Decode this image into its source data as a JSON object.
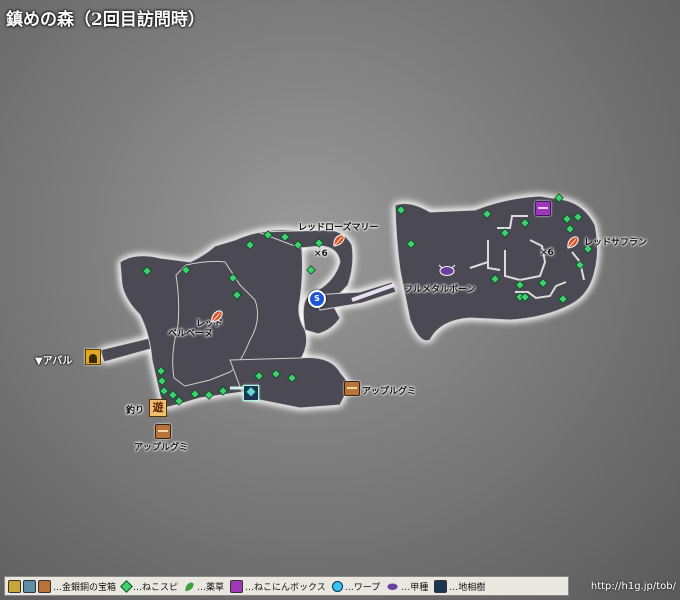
{
  "title": "鎮めの森（2回目訪問時）",
  "labels": {
    "red_rosemary": "レッドローズマリー",
    "x6_a": "×6",
    "red_berbena_1": "レッド",
    "red_berbena_2": "ベルベーヌ",
    "red_saffron": "レッドサフラン",
    "x6_b": "×6",
    "full_metal_bone": "フルメタルボーン",
    "apple_gummy_1": "アップルグミ",
    "apple_gummy_2": "アップルグミ",
    "fishing": "釣り",
    "fishing_icon": "遊",
    "exit_abal": "▼アバル",
    "warp_letter": "S"
  },
  "legend": {
    "chests": "…金銀銅の宝箱",
    "cat_spot": "…ねこスピ",
    "herb": "…薬草",
    "cat_box": "…ねこにんボックス",
    "warp": "…ワープ",
    "beetle": "…甲種",
    "tree": "…地相樹"
  },
  "credit": "http://h1g.jp/tob/",
  "colors": {
    "terrain_fill": "#4b4a52",
    "terrain_glow": "#ffffff",
    "cat_spot": "#3fd070",
    "herb": "#d9542a"
  },
  "icons": [
    "chest-icon",
    "cat-spot-icon",
    "herb-icon",
    "cat-box-icon",
    "warp-icon",
    "beetle-icon",
    "tree-icon",
    "gate-icon",
    "fishing-icon"
  ]
}
